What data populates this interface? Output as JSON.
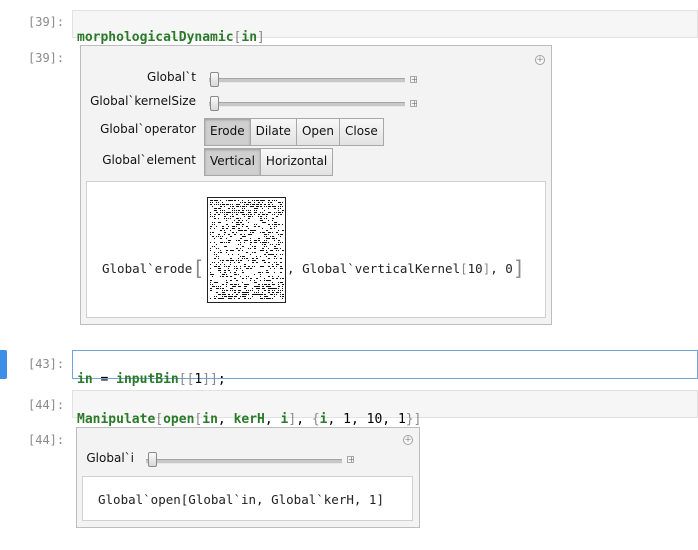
{
  "cells": {
    "in39": {
      "label": "[39]:",
      "fn": "morphologicalDynamic",
      "open": "[",
      "arg": "in",
      "close": "]"
    },
    "out39": {
      "label": "[39]:",
      "controls": {
        "t_label": "Global`t",
        "kernel_label": "Global`kernelSize",
        "operator_label": "Global`operator",
        "element_label": "Global`element",
        "operators": [
          "Erode",
          "Dilate",
          "Open",
          "Close"
        ],
        "operator_selected": "Erode",
        "elements": [
          "Vertical",
          "Horizontal"
        ],
        "element_selected": "Vertical",
        "t_value": 0.0,
        "kernel_value": 0.0
      },
      "output": {
        "head": "Global`erode",
        "lbr": "[",
        "comma1": ",",
        "arg2": "Global`verticalKernel",
        "arg2_open": "[",
        "arg2_num": "10",
        "arg2_close": "]",
        "comma2": ",",
        "arg3": "0",
        "rbr": "]"
      }
    },
    "in43": {
      "label": "[43]:",
      "var": "in",
      "eq": " = ",
      "fn": "inputBin",
      "open": "[[",
      "num": "1",
      "close": "]]",
      "semi": ";"
    },
    "in44": {
      "label": "[44]:",
      "fn": "Manipulate",
      "open": "[",
      "inner_fn": "open",
      "inner_open": "[",
      "a1": "in",
      "c1": ", ",
      "a2": "kerH",
      "c2": ", ",
      "a3": "i",
      "inner_close": "]",
      "c3": ", ",
      "lbrace": "{",
      "it": "i",
      "c4": ", ",
      "n1": "1",
      "c5": ", ",
      "n2": "10",
      "c6": ", ",
      "n3": "1",
      "rbrace": "}",
      "close": "]"
    },
    "out44": {
      "label": "[44]:",
      "i_label": "Global`i",
      "i_value": 0.0,
      "output": "Global`open[Global`in, Global`kerH, 1]"
    }
  },
  "colors": {
    "keyword": "#2a7a2a",
    "active_bar": "#3d8ee6"
  }
}
